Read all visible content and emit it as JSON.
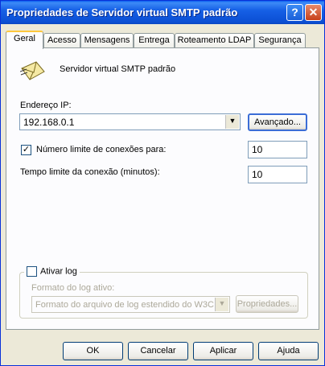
{
  "window": {
    "title": "Propriedades de Servidor virtual SMTP padrão",
    "help_glyph": "?",
    "close_glyph": "✕"
  },
  "tabs": [
    {
      "label": "Geral",
      "active": true
    },
    {
      "label": "Acesso",
      "active": false
    },
    {
      "label": "Mensagens",
      "active": false
    },
    {
      "label": "Entrega",
      "active": false
    },
    {
      "label": "Roteamento LDAP",
      "active": false
    },
    {
      "label": "Segurança",
      "active": false
    }
  ],
  "general": {
    "server_name": "Servidor virtual SMTP padrão",
    "server_icon": "envelope-icon",
    "ip_label": "Endereço IP:",
    "ip_value": "192.168.0.1",
    "advanced_button": "Avançado...",
    "limit_connections_label": "Número limite de conexões para:",
    "limit_connections_checked": true,
    "limit_connections_value": "10",
    "timeout_label": "Tempo limite da conexão (minutos):",
    "timeout_value": "10"
  },
  "logging": {
    "enable_label": "Ativar log",
    "enable_checked": false,
    "format_label": "Formato do log ativo:",
    "format_value": "Formato do arquivo de log estendido do W3C",
    "properties_button": "Propriedades..."
  },
  "buttons": {
    "ok": "OK",
    "cancel": "Cancelar",
    "apply": "Aplicar",
    "help": "Ajuda"
  },
  "colors": {
    "titlebar": "#0b4fd4",
    "window_bg": "#ece9d8",
    "tab_highlight": "#ffc83c"
  }
}
